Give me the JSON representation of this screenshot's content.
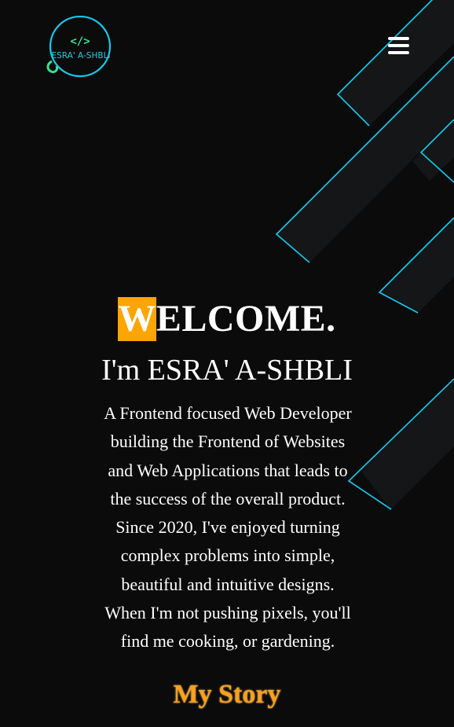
{
  "brand": {
    "logo_text": "ESRA' A-SHBLI",
    "logo_code_symbol": "</>",
    "accent_cyan": "#18c6e6",
    "accent_green": "#3adf8e"
  },
  "nav": {
    "menu_icon": "hamburger-menu-icon"
  },
  "hero": {
    "welcome_first_letter": "W",
    "welcome_rest": "ELCOME.",
    "welcome_highlight_color": "#ffa500",
    "name_line": "I'm ESRA' A-SHBLI",
    "bio_lines": [
      "A Frontend focused Web Developer",
      "building the Frontend of Websites",
      "and Web Applications that leads to",
      "the success of the overall product.",
      "Since 2020, I've enjoyed turning",
      "complex problems into simple,",
      "beautiful and intuitive designs.",
      "When I'm not pushing pixels, you'll",
      "find me cooking, or gardening."
    ],
    "story_link": "My Story",
    "story_color": "#ffa01a"
  },
  "theme": {
    "background": "#0b0b0c",
    "panel": "#161718",
    "line_cyan": "#17c4e6"
  }
}
